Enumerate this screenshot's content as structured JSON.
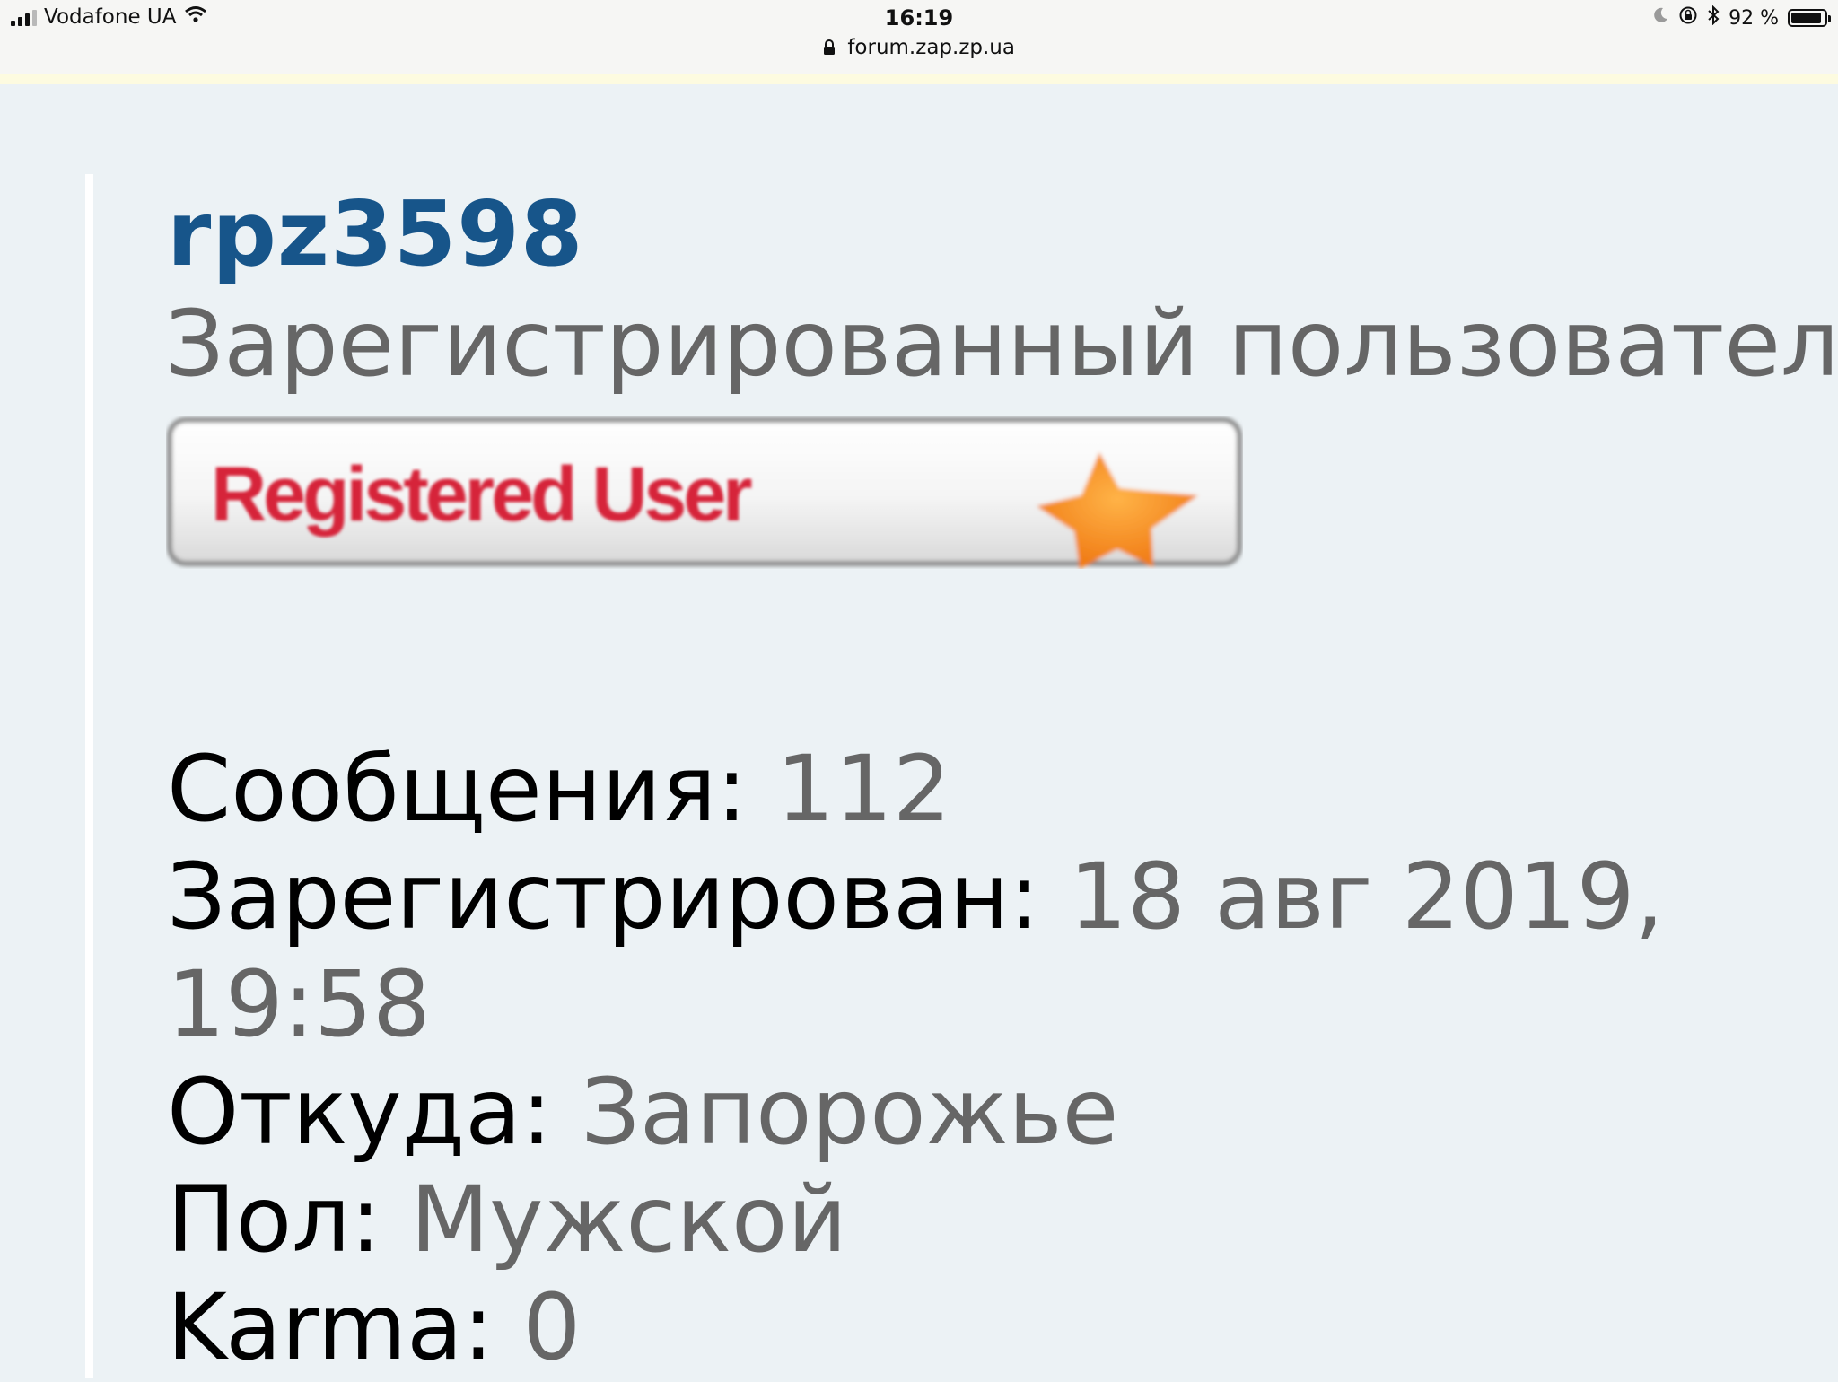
{
  "statusbar": {
    "carrier": "Vodafone UA",
    "time": "16:19",
    "url": "forum.zap.zp.ua",
    "battery": "92 %",
    "battery_level": 0.92
  },
  "profile": {
    "username": "rpz3598",
    "usertitle": "Зарегистрированный пользователь",
    "rank_badge_text": "Registered User",
    "posts_label": "Сообщения:",
    "posts_value": "112",
    "registered_label": "Зарегистрирован:",
    "registered_value_1": "18 авг 2019,",
    "registered_value_2": "19:58",
    "location_label": "Откуда:",
    "location_value": "Запорожье",
    "gender_label": "Пол:",
    "gender_value": "Мужской",
    "karma_label": "Karma:",
    "karma_value": "0"
  },
  "colors": {
    "username": "#17558a",
    "value_text": "#666666",
    "background": "#ecf2f5",
    "badge_text": "#d6243a",
    "badge_star": "#f7921e"
  }
}
